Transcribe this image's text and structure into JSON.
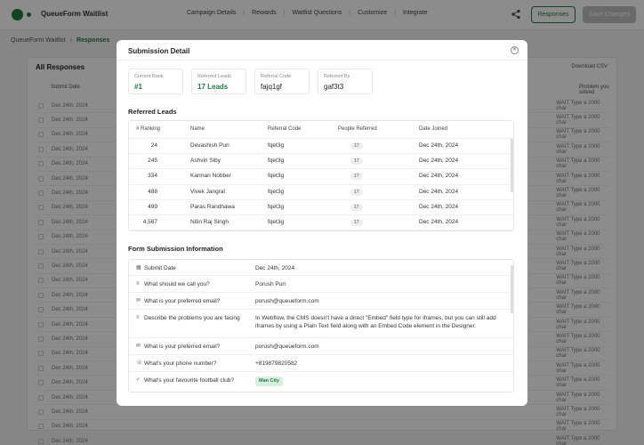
{
  "app": {
    "name": "QueueForm Waitlist",
    "nav": [
      "Campaign Details",
      "Rewards",
      "Waitlist Questions",
      "Customize",
      "Integrate"
    ],
    "responses_label": "Responses",
    "publish_label": "Save Changes"
  },
  "breadcrumb": {
    "parent": "QueueForm Waitlist",
    "current": "Responses"
  },
  "bg_table": {
    "title": "All Responses",
    "download_label": "Download CSV",
    "col_date": "Submit Date",
    "col_right": "Problem you solved",
    "row_date": "Dec 24th, 2024",
    "row_text": "WAIT Type a 2000 char",
    "row_count": 24
  },
  "modal": {
    "title": "Submission Detail",
    "close_icon": "close-icon",
    "stats": [
      {
        "label": "Current Rank",
        "value": "#1",
        "accent": true
      },
      {
        "label": "Referred Leads",
        "value": "17 Leads",
        "accent": true
      },
      {
        "label": "Referral Code",
        "value": "fajq1gf",
        "accent": false
      },
      {
        "label": "Referred By",
        "value": "gaf3t3",
        "accent": false
      }
    ],
    "referred_leads_title": "Referred Leads",
    "leads_columns": {
      "rank": "# Ranking",
      "name": "Name",
      "code": "Referral Code",
      "people": "People Referred",
      "date": "Date Joined"
    },
    "leads": [
      {
        "rank": "24",
        "name": "Devashish Puri",
        "code": "fqet3g",
        "people": "17",
        "date": "Dec 24th, 2024"
      },
      {
        "rank": "245",
        "name": "Ashvin Siby",
        "code": "fqet3g",
        "people": "17",
        "date": "Dec 24th, 2024"
      },
      {
        "rank": "334",
        "name": "Karman Nobber",
        "code": "fqet3g",
        "people": "17",
        "date": "Dec 24th, 2024"
      },
      {
        "rank": "488",
        "name": "Vivek Jangral",
        "code": "fqet3g",
        "people": "17",
        "date": "Dec 24th, 2024"
      },
      {
        "rank": "499",
        "name": "Paras Randhawa",
        "code": "fqet3g",
        "people": "17",
        "date": "Dec 24th, 2024"
      },
      {
        "rank": "4,567",
        "name": "Nitin Raj Singh",
        "code": "fqet3g",
        "people": "17",
        "date": "Dec 24th, 2024"
      }
    ],
    "form_title": "Form Submission Information",
    "form_rows": [
      {
        "icon": "calendar-icon",
        "glyph": "▦",
        "q": "Submit Date",
        "a": "Dec 24th, 2024"
      },
      {
        "icon": "text-icon",
        "glyph": "≡",
        "q": "What should we call you?",
        "a": "Porush Puri"
      },
      {
        "icon": "mail-icon",
        "glyph": "✉",
        "q": "What is your preferred email?",
        "a": "porush@queueform.com"
      },
      {
        "icon": "paragraph-icon",
        "glyph": "≡",
        "q": "Describe the problems you are facing",
        "a": "In Webflow, the CMS doesn't have a direct \"Embed\" field type for iframes, but you can still add iframes by using a Plain Text field along with an Embed Code element in the Designer."
      },
      {
        "icon": "mail-icon",
        "glyph": "✉",
        "q": "What is your preferred email?",
        "a": "porush@queueform.com"
      },
      {
        "icon": "phone-icon",
        "glyph": "☏",
        "q": "What's your phone number?",
        "a": "+819879820582"
      },
      {
        "icon": "check-icon",
        "glyph": "✓",
        "q": "What's your favourite football club?",
        "a": "Man City",
        "tag": true
      }
    ]
  }
}
